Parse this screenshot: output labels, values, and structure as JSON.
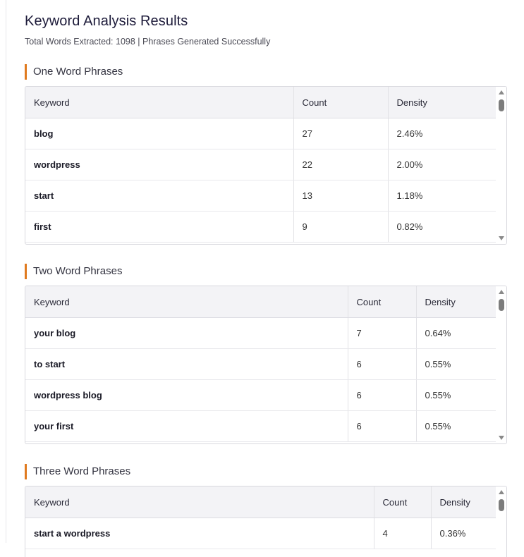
{
  "header": {
    "title": "Keyword Analysis Results",
    "subtitle": "Total Words Extracted: 1098 | Phrases Generated Successfully"
  },
  "accent_color": "#e07a1f",
  "sections": [
    {
      "heading": "One Word Phrases",
      "columns": [
        "Keyword",
        "Count",
        "Density"
      ],
      "rows": [
        {
          "keyword": "blog",
          "count": "27",
          "density": "2.46%"
        },
        {
          "keyword": "wordpress",
          "count": "22",
          "density": "2.00%"
        },
        {
          "keyword": "start",
          "count": "13",
          "density": "1.18%"
        },
        {
          "keyword": "first",
          "count": "9",
          "density": "0.82%"
        }
      ]
    },
    {
      "heading": "Two Word Phrases",
      "columns": [
        "Keyword",
        "Count",
        "Density"
      ],
      "rows": [
        {
          "keyword": "your blog",
          "count": "7",
          "density": "0.64%"
        },
        {
          "keyword": "to start",
          "count": "6",
          "density": "0.55%"
        },
        {
          "keyword": "wordpress blog",
          "count": "6",
          "density": "0.55%"
        },
        {
          "keyword": "your first",
          "count": "6",
          "density": "0.55%"
        }
      ]
    },
    {
      "heading": "Three Word Phrases",
      "columns": [
        "Keyword",
        "Count",
        "Density"
      ],
      "rows": [
        {
          "keyword": "start a wordpress",
          "count": "4",
          "density": "0.36%"
        }
      ]
    }
  ]
}
